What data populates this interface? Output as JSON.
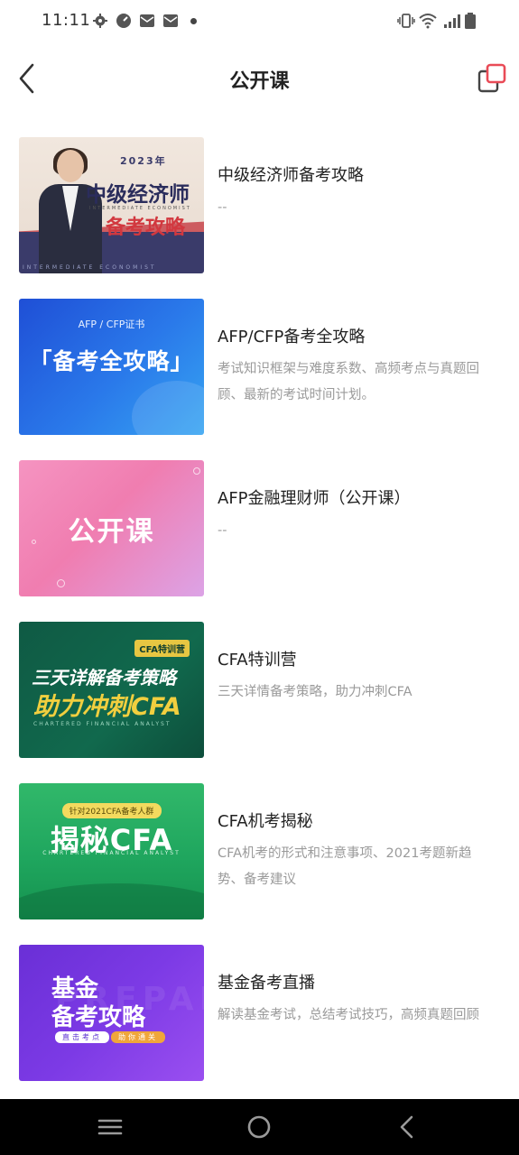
{
  "status_bar": {
    "time": "11:11",
    "left_icons": [
      "gear-icon",
      "speed-icon",
      "mail-icon",
      "mail-icon",
      "dot-icon"
    ],
    "right_icons": [
      "vibrate-icon",
      "wifi-icon",
      "signal-icon",
      "battery-icon"
    ]
  },
  "header": {
    "title": "公开课",
    "back_icon": "chevron-left-icon",
    "action_icon": "copy-icon",
    "accent_color": "#e94b57"
  },
  "courses": [
    {
      "title": "中级经济师备考攻略",
      "description": "--",
      "thumbnail": {
        "year": "2023年",
        "line1": "中级经济师",
        "line2": "备考攻略",
        "sub": "INTERMEDIATE ECONOMIST",
        "foot": "INTERMEDIATE ECONOMIST"
      }
    },
    {
      "title": "AFP/CFP备考全攻略",
      "description": "考试知识框架与难度系数、高频考点与真题回顾、最新的考试时间计划。",
      "thumbnail": {
        "top": "AFP / CFP证书",
        "main": "「备考全攻略」"
      }
    },
    {
      "title": "AFP金融理财师（公开课）",
      "description": "--",
      "thumbnail": {
        "main": "公开课"
      }
    },
    {
      "title": "CFA特训营",
      "description": "三天详情备考策略，助力冲刺CFA",
      "thumbnail": {
        "tag": "CFA特训营",
        "line1": "三天详解备考策略",
        "line2": "助力冲刺CFA",
        "line3": "CHARTERED FINANCIAL ANALYST"
      }
    },
    {
      "title": "CFA机考揭秘",
      "description": "CFA机考的形式和注意事项、2021考题新趋势、备考建议",
      "thumbnail": {
        "tag": "针对2021CFA备考人群",
        "main": "揭秘CFA",
        "sub": "CHARTERED FINANCIAL ANALYST"
      }
    },
    {
      "title": "基金备考直播",
      "description": "解读基金考试，总结考试技巧，高频真题回顾",
      "thumbnail": {
        "line1": "基金",
        "line2": "备考攻略",
        "tag1": "直击考点",
        "tag2": "助你通关",
        "ghost": "PREPAR"
      }
    }
  ],
  "nav_bar": {
    "icons": [
      "menu-icon",
      "home-circle-icon",
      "back-icon"
    ]
  }
}
